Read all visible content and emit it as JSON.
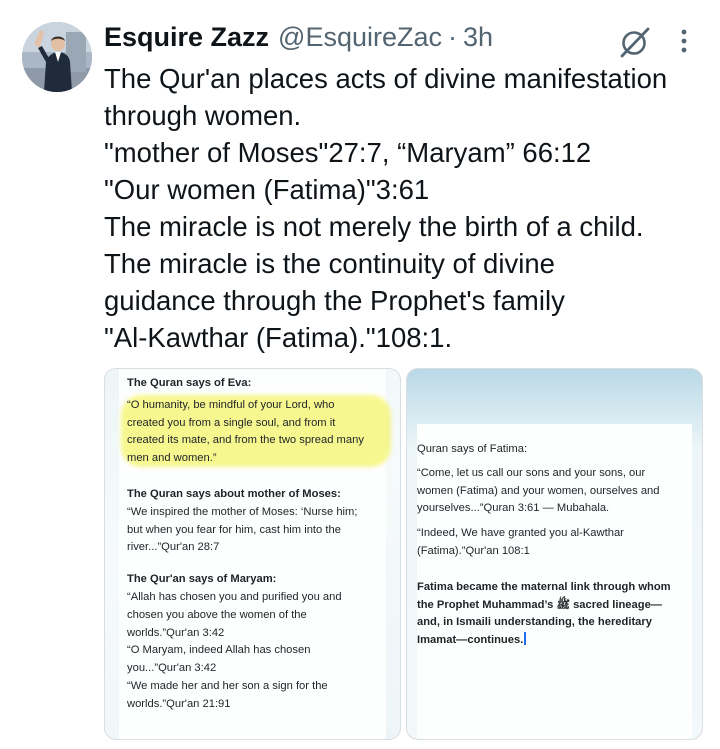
{
  "tweet": {
    "display_name": "Esquire Zazz",
    "handle": "@EsquireZac",
    "separator": "·",
    "time": "3h",
    "lines": [
      "The Qur'an places acts of divine manifestation",
      "through women.",
      "\"mother of Moses\"27:7, “Maryam” 66:12",
      "\"Our women (Fatima)\"3:61",
      "The miracle is not merely the birth of a child.",
      "The miracle is the continuity of divine",
      "guidance through the Prophet's family",
      "\"Al-Kawthar (Fatima).\"108:1."
    ]
  },
  "image_left": {
    "heading_eva": "The Quran says of Eva:",
    "eva_lines": [
      "“O humanity, be mindful of your Lord, who",
      "created you from a single soul, and from it",
      "created its mate, and from the two spread many",
      "men and women.”"
    ],
    "heading_moses": "The Quran says about mother of Moses:",
    "moses_lines": [
      "“We inspired the mother of Moses: ‘Nurse him;",
      "but when you fear for him, cast him into the",
      "river...”Qur'an 28:7"
    ],
    "heading_maryam": "The Qur'an says of Maryam:",
    "maryam_lines": [
      "“Allah has chosen you and purified you and",
      "chosen you above the women of the",
      "worlds.”Qur'an 3:42",
      "“O Maryam, indeed Allah has chosen",
      "you...”Qur'an 3:42",
      "“We made her and her son a sign for the",
      "worlds.”Qur'an 21:91"
    ]
  },
  "image_right": {
    "heading": "Quran says of Fatima:",
    "quote1_lines": [
      "“Come, let us call our sons and your sons, our",
      "women (Fatima) and your women, ourselves and",
      "yourselves...”Quran 3:61 — Mubahala."
    ],
    "quote2_lines": [
      "“Indeed, We have granted you al-Kawthar",
      "(Fatima).”Qur'an 108:1"
    ],
    "bold_lines": [
      "Fatima became the maternal link through whom",
      "the Prophet Muhammad’s ﷺ sacred lineage—",
      "and, in Ismaili understanding, the hereditary",
      "Imamat—continues."
    ]
  },
  "colors": {
    "highlight": "#f6f56a",
    "text": "#0f1419",
    "muted": "#536471"
  },
  "icons": [
    "avatar-photo",
    "grok-icon",
    "more-icon"
  ]
}
